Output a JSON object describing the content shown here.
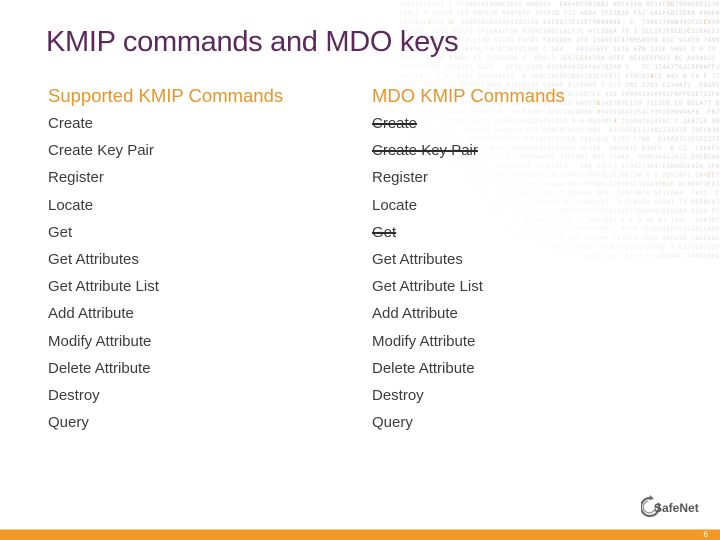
{
  "slide": {
    "title": "KMIP commands and MDO keys",
    "page_number": "6",
    "brand": "SafeNet",
    "colors": {
      "title": "#5b2a5c",
      "column_header": "#e4962a",
      "body_text": "#3c3c3c",
      "footer_bar": "#f29a25"
    }
  },
  "columns": {
    "supported": {
      "header": "Supported KMIP Commands",
      "items": [
        {
          "label": "Create"
        },
        {
          "label": "Create Key Pair"
        },
        {
          "label": "Register"
        },
        {
          "label": "Locate"
        },
        {
          "label": "Get"
        },
        {
          "label": "Get Attributes"
        },
        {
          "label": "Get Attribute List"
        },
        {
          "label": "Add Attribute"
        },
        {
          "label": "Modify Attribute"
        },
        {
          "label": "Delete Attribute"
        },
        {
          "label": "Destroy"
        },
        {
          "label": "Query"
        }
      ]
    },
    "mdo": {
      "header": "MDO KMIP Commands",
      "items": [
        {
          "label": "Create",
          "struck": true
        },
        {
          "label": "Create Key Pair",
          "struck": true
        },
        {
          "label": "Register",
          "struck": false
        },
        {
          "label": "Locate",
          "struck": false
        },
        {
          "label": "Get",
          "struck": true
        },
        {
          "label": "Get Attributes",
          "struck": false
        },
        {
          "label": "Get Attribute List",
          "struck": false
        },
        {
          "label": "Add Attribute",
          "struck": false
        },
        {
          "label": "Modify Attribute",
          "struck": false
        },
        {
          "label": "Delete Attribute",
          "struck": false
        },
        {
          "label": "Destroy",
          "struck": false
        },
        {
          "label": "Query",
          "struck": false
        }
      ]
    }
  }
}
